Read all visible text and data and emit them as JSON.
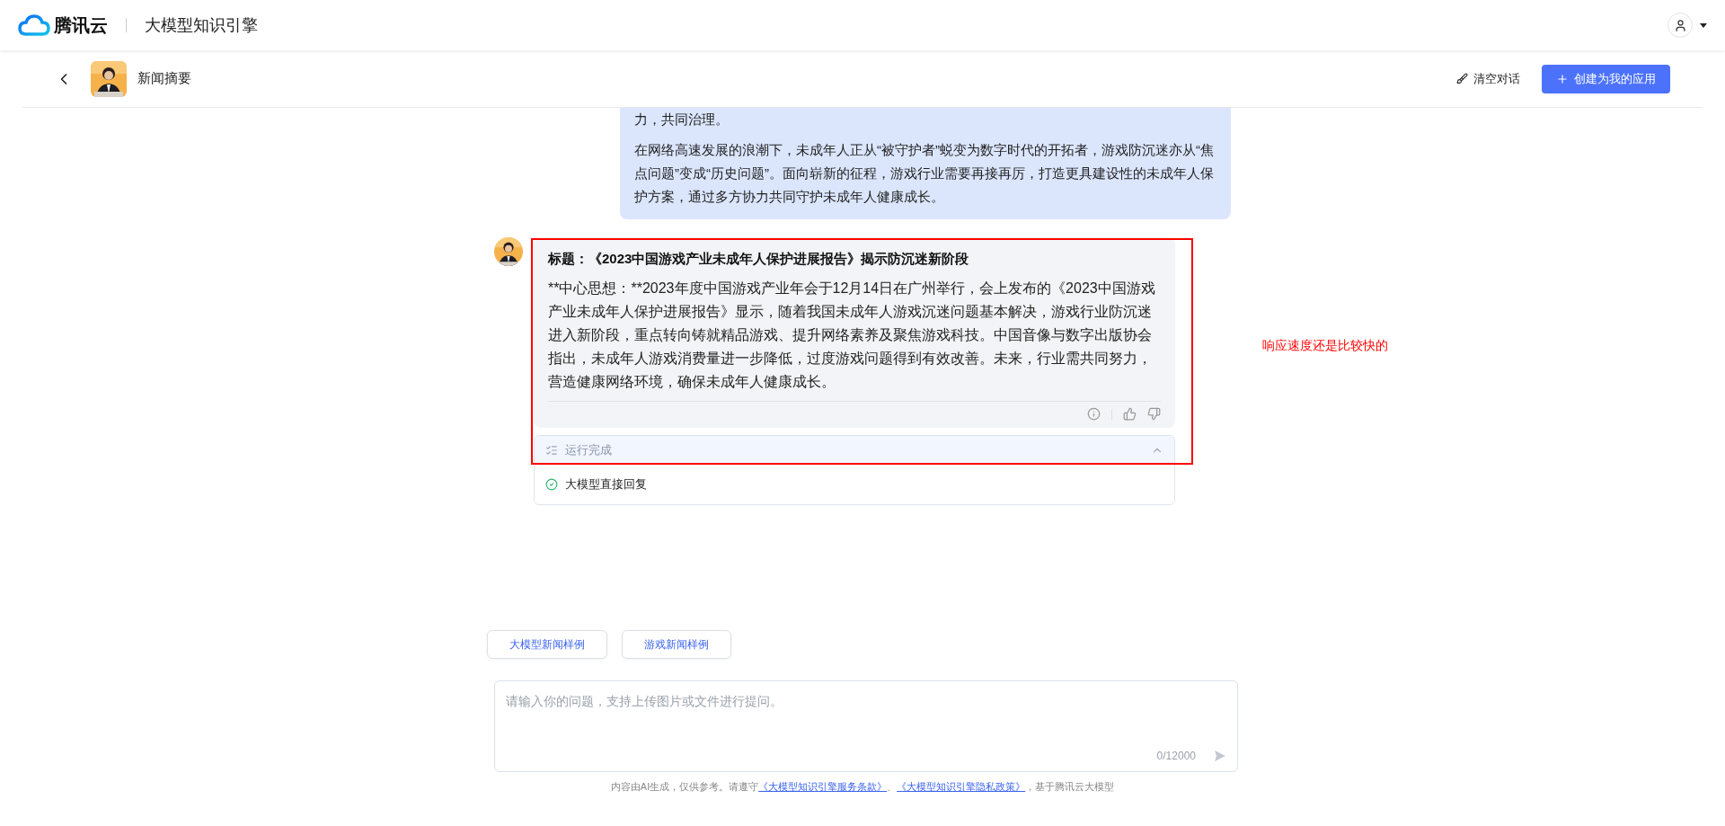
{
  "topbar": {
    "brand": "腾讯云",
    "product": "大模型知识引擎"
  },
  "header": {
    "title": "新闻摘要",
    "clear_button": "清空对话",
    "create_button": "创建为我的应用"
  },
  "messages": [
    {
      "kind": "user",
      "paragraphs": [
        "力，共同治理。",
        "在网络高速发展的浪潮下，未成年人正从“被守护者”蜕变为数字时代的开拓者，游戏防沉迷亦从“焦点问题”变成“历史问题”。面向崭新的征程，游戏行业需要再接再厉，打造更具建设性的未成年人保护方案，通过多方协力共同守护未成年人健康成长。"
      ]
    },
    {
      "kind": "bot",
      "title": "标题：《2023中国游戏产业未成年人保护进展报告》揭示防沉迷新阶段",
      "body": "**中心思想：**2023年度中国游戏产业年会于12月14日在广州举行，会上发布的《2023中国游戏产业未成年人保护进展报告》显示，随着我国未成年人游戏沉迷问题基本解决，游戏行业防沉迷进入新阶段，重点转向铸就精品游戏、提升网络素养及聚焦游戏科技。中国音像与数字出版协会指出，未成年人游戏消费量进一步降低，过度游戏问题得到有效改善。未来，行业需共同努力，营造健康网络环境，确保未成年人健康成长。",
      "run_panel": {
        "status": "运行完成",
        "expanded": true,
        "steps": [
          {
            "label": "大模型直接回复",
            "done": true
          }
        ]
      }
    }
  ],
  "annotation": {
    "note": "响应速度还是比较快的"
  },
  "samples": [
    "大模型新闻样例",
    "游戏新闻样例"
  ],
  "input": {
    "placeholder": "请输入你的问题，支持上传图片或文件进行提问。",
    "counter": "0/12000"
  },
  "footer": {
    "text": "内容由AI生成，仅供参考。请遵守",
    "links": [
      "《大模型知识引擎服务条款》",
      "《大模型知识引擎隐私政策》"
    ],
    "separator": "、",
    "suffix": "，基于腾讯云大模型"
  }
}
